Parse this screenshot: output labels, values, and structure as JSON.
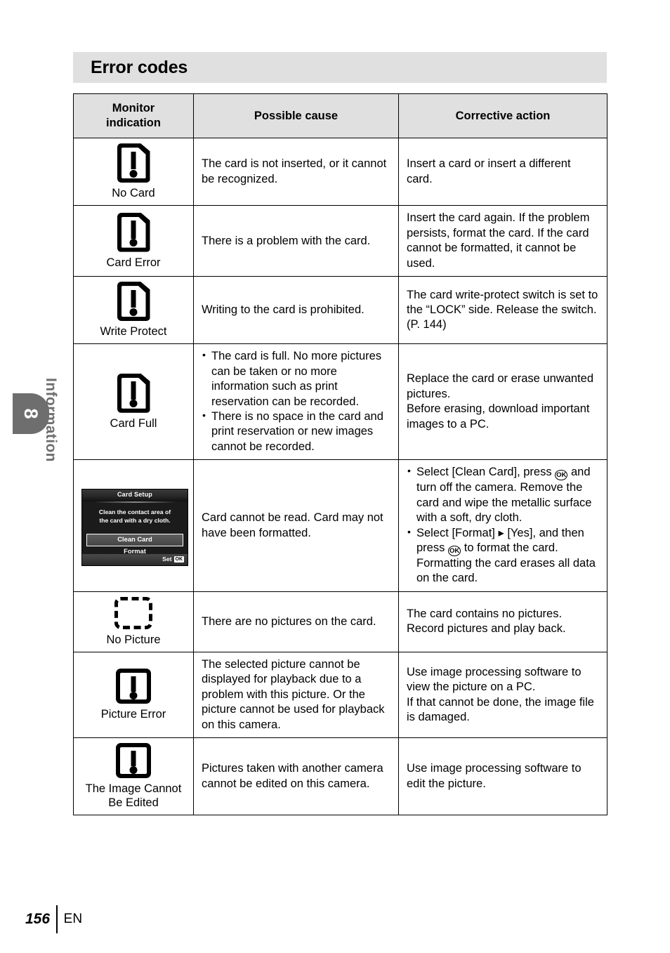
{
  "section": {
    "title": "Error codes"
  },
  "rail": {
    "chapter_number": "8",
    "chapter_name": "Information"
  },
  "table": {
    "headers": {
      "monitor_indication": "Monitor\nindication",
      "monitor_indication_line1": "Monitor",
      "monitor_indication_line2": "indication",
      "possible_cause": "Possible cause",
      "corrective_action": "Corrective action"
    },
    "rows": [
      {
        "icon": "card-exclamation-icon",
        "label": "No Card",
        "cause": "The card is not inserted, or it cannot be recognized.",
        "action": "Insert a card or insert a different card."
      },
      {
        "icon": "card-exclamation-icon",
        "label": "Card Error",
        "cause": "There is a problem with the card.",
        "action": "Insert the card again. If the problem persists, format the card. If the card cannot be formatted, it cannot be used."
      },
      {
        "icon": "card-exclamation-icon",
        "label": "Write Protect",
        "cause": "Writing to the card is prohibited.",
        "action": "The card write-protect switch is set to the “LOCK” side. Release the switch. (P. 144)"
      },
      {
        "icon": "card-exclamation-icon",
        "label": "Card Full",
        "cause_bullets": [
          "The card is full. No more pictures can be taken or no more information such as print reservation can be recorded.",
          "There is no space in the card and print reservation or new images cannot be recorded."
        ],
        "action_lines": [
          "Replace the card or erase unwanted pictures.",
          "Before erasing, download important images to a PC."
        ]
      },
      {
        "icon": "camera-monitor-card-setup-screen",
        "label": "",
        "cause": "Card cannot be read. Card may not have been formatted.",
        "action_bullets": [
          {
            "pre": "Select [Clean Card], press ",
            "ok": "OK",
            "post": " and turn off the camera. Remove the card and wipe the metallic surface with a soft, dry cloth."
          },
          {
            "pre": "Select [Format] ▸ [Yes], and then press ",
            "ok": "OK",
            "post": " to format the card. Formatting the card erases all data on the card."
          }
        ]
      },
      {
        "icon": "dashed-frame-icon",
        "label": "No Picture",
        "cause": "There are no pictures on the card.",
        "action_lines": [
          "The card contains no pictures.",
          "Record pictures and play back."
        ]
      },
      {
        "icon": "square-exclamation-icon",
        "label": "Picture Error",
        "cause": "The selected picture cannot be displayed for playback due to a problem with this picture. Or the picture cannot be used for playback on this camera.",
        "action_lines": [
          "Use image processing software to view the picture on a PC.",
          "If that cannot be done, the image file is damaged."
        ]
      },
      {
        "icon": "square-exclamation-icon",
        "label": "The Image Cannot Be Edited",
        "label_line1": "The Image Cannot",
        "label_line2": "Be Edited",
        "cause": "Pictures taken with another camera cannot be edited on this camera.",
        "action": "Use image processing software to edit the picture."
      }
    ]
  },
  "monitor_screen": {
    "title": "Card Setup",
    "message_line1": "Clean the contact area of",
    "message_line2": "the card with a dry cloth.",
    "selected_item": "Clean Card",
    "option_item": "Format",
    "footer_label": "Set",
    "footer_badge": "OK"
  },
  "footer": {
    "page_number": "156",
    "language": "EN"
  },
  "colors": {
    "header_band": "#e0e0e0",
    "rail_gray": "#6e6e6e",
    "monitor_bg": "#1b1b1b",
    "text": "#000000"
  }
}
